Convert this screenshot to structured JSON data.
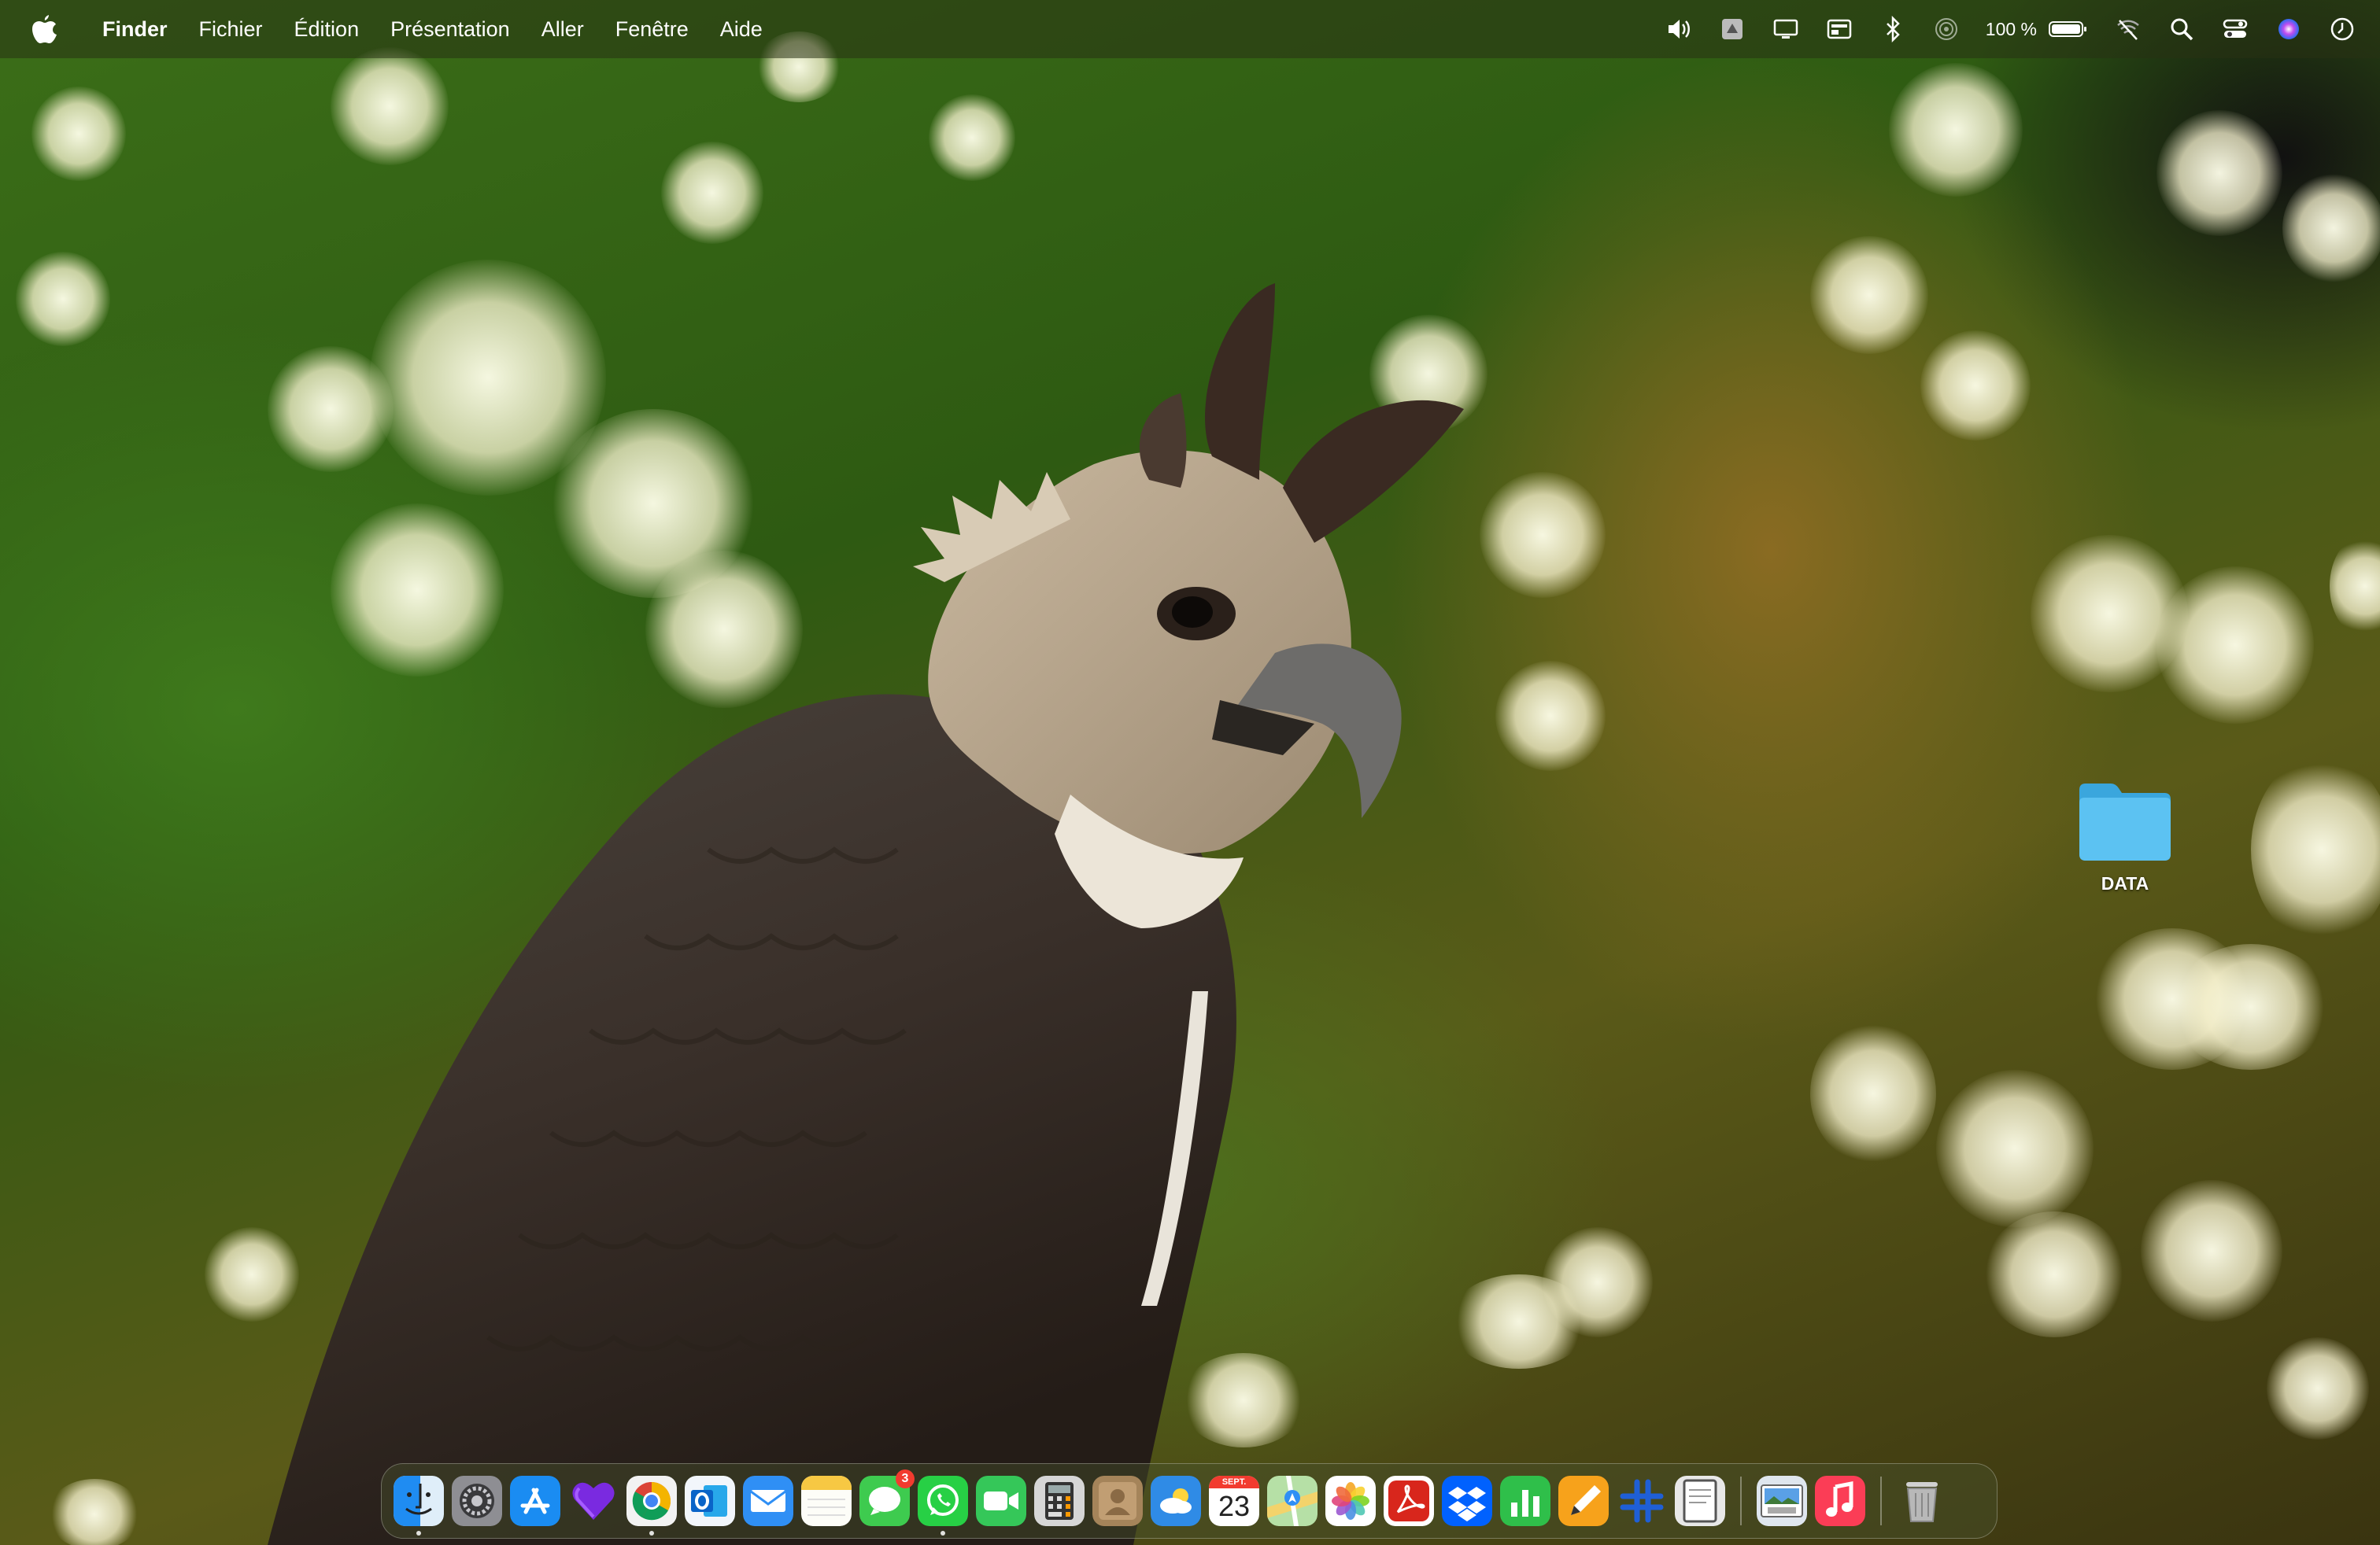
{
  "menubar": {
    "apple_icon": "apple-logo-icon",
    "app_name": "Finder",
    "items": [
      "Fichier",
      "Édition",
      "Présentation",
      "Aller",
      "Fenêtre",
      "Aide"
    ],
    "status": {
      "battery_percent": "100 %",
      "icons": [
        "volume-icon",
        "backup-icon",
        "display-icon",
        "keyboard-layout-icon",
        "bluetooth-icon",
        "airdrop-icon",
        "battery-icon",
        "wifi-off-icon",
        "spotlight-search-icon",
        "control-center-icon",
        "siri-icon",
        "clock-icon"
      ]
    }
  },
  "desktop": {
    "items": [
      {
        "label": "DATA",
        "icon": "folder-icon"
      }
    ]
  },
  "dock": {
    "apps": [
      {
        "icon": "finder-icon",
        "running": true
      },
      {
        "icon": "system-settings-icon",
        "running": false
      },
      {
        "icon": "app-store-icon",
        "running": false
      },
      {
        "icon": "purple-heart-app-icon",
        "running": false
      },
      {
        "icon": "chrome-icon",
        "running": true
      },
      {
        "icon": "outlook-icon",
        "running": false
      },
      {
        "icon": "mail-icon",
        "running": false
      },
      {
        "icon": "notes-icon",
        "running": false
      },
      {
        "icon": "messages-icon",
        "running": false,
        "badge": "3"
      },
      {
        "icon": "whatsapp-icon",
        "running": true
      },
      {
        "icon": "facetime-icon",
        "running": false
      },
      {
        "icon": "calculator-icon",
        "running": false
      },
      {
        "icon": "contacts-icon",
        "running": false
      },
      {
        "icon": "weather-icon",
        "running": false
      },
      {
        "icon": "calendar-icon",
        "running": false,
        "month": "SEPT.",
        "day": "23"
      },
      {
        "icon": "maps-icon",
        "running": false
      },
      {
        "icon": "photos-icon",
        "running": false
      },
      {
        "icon": "acrobat-icon",
        "running": false
      },
      {
        "icon": "dropbox-icon",
        "running": false
      },
      {
        "icon": "numbers-icon",
        "running": false
      },
      {
        "icon": "pages-icon",
        "running": false
      },
      {
        "icon": "slack-icon",
        "running": false
      },
      {
        "icon": "textedit-icon",
        "running": false
      }
    ],
    "recent_apps": [
      {
        "icon": "preview-icon",
        "running": false
      },
      {
        "icon": "music-icon",
        "running": false
      }
    ],
    "trash": {
      "icon": "trash-icon"
    }
  }
}
